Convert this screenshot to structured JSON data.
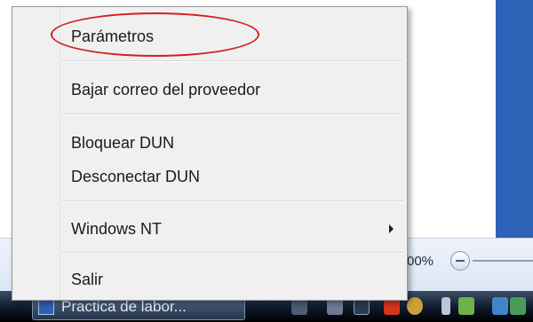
{
  "status_bar": {
    "zoom_text": "00%"
  },
  "taskbar": {
    "active_task_label": "Practica de labor...",
    "tray_icons": [
      "pin-icon",
      "keyboard-icon",
      "speaker-icon",
      "office-icon",
      "security-icon",
      "network-plug-icon",
      "network-icon",
      "display-icon"
    ]
  },
  "menu": {
    "items": [
      {
        "label": "Parámetros",
        "icon": "",
        "highlighted": true
      },
      {
        "label": "Bajar correo del proveedor"
      },
      {
        "label": "Bloquear DUN"
      },
      {
        "label": "Desconectar DUN"
      },
      {
        "label": "Windows NT",
        "submenu": true
      },
      {
        "label": "Salir"
      }
    ]
  },
  "colors": {
    "annotation": "#d42020",
    "desktop_blue": "#2f63b8"
  }
}
